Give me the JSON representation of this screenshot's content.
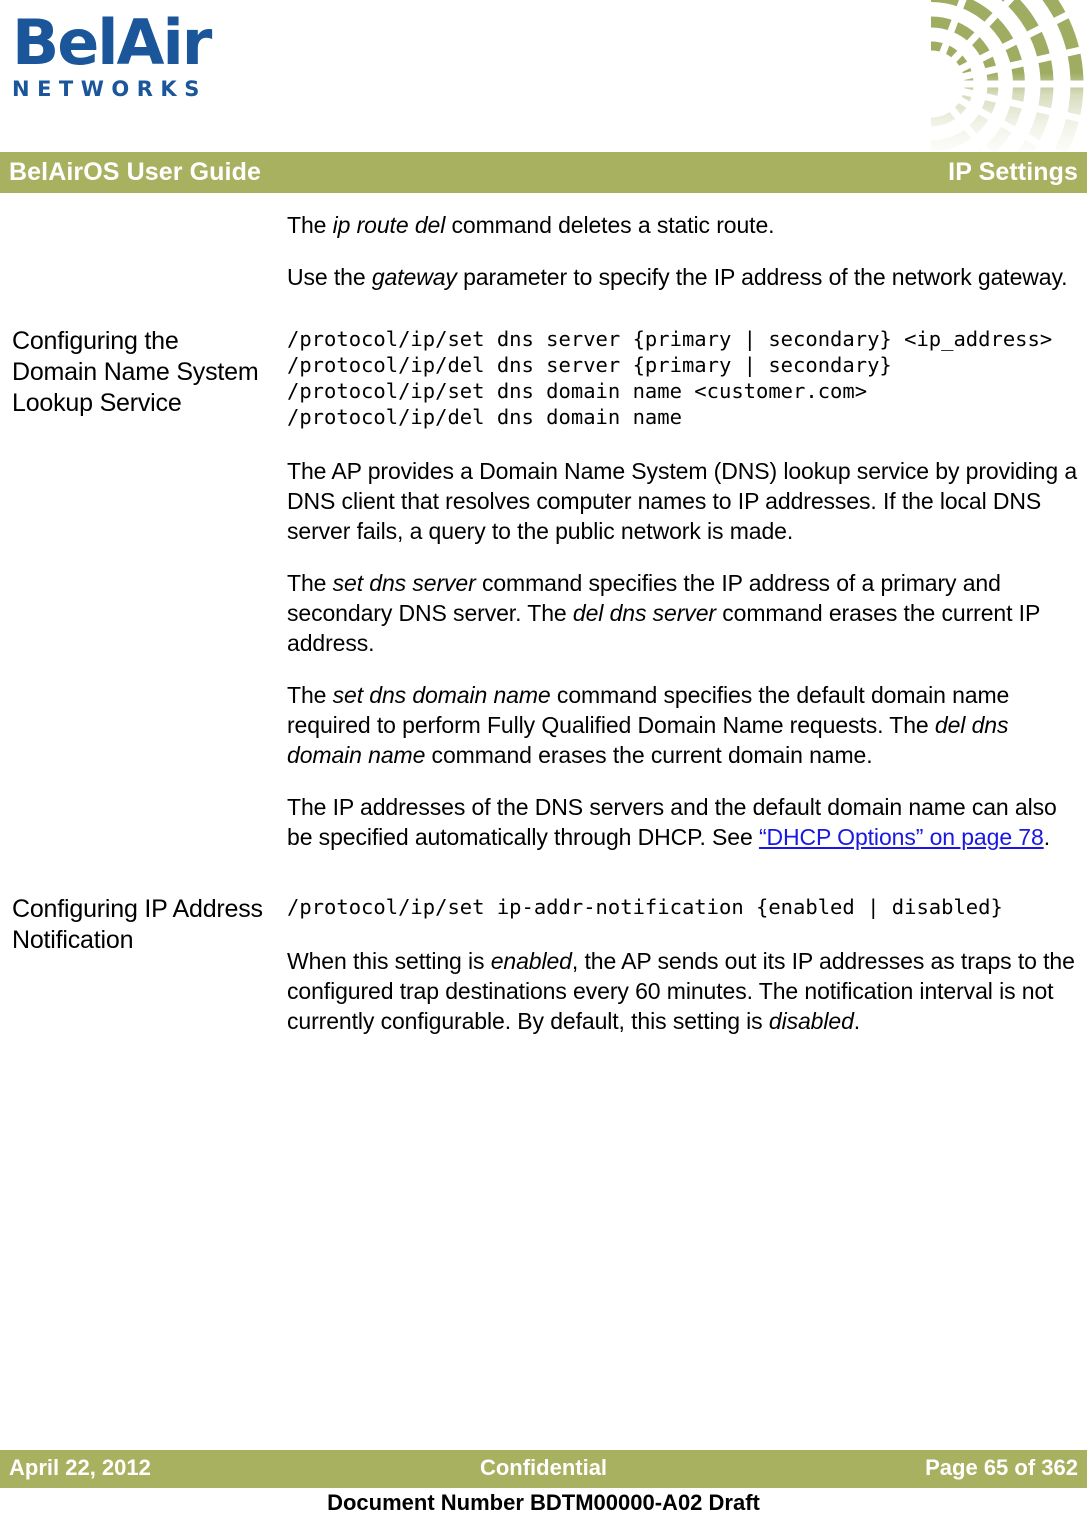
{
  "brand": {
    "logo_wordmark": "BelAir",
    "logo_subword": "NETWORKS",
    "logo_color": "#1A5699",
    "accent_color": "#A8B160",
    "link_color": "#1A18E0"
  },
  "header": {
    "title": "BelAirOS User Guide",
    "section": "IP Settings",
    "decor_icon": "radial-fan-graphic"
  },
  "intro": {
    "paragraphs": [
      {
        "runs": [
          {
            "t": "The ",
            "style": "normal"
          },
          {
            "t": "ip route del",
            "style": "italic"
          },
          {
            "t": " command deletes a static route.",
            "style": "normal"
          }
        ]
      },
      {
        "runs": [
          {
            "t": "Use the ",
            "style": "normal"
          },
          {
            "t": "gateway",
            "style": "italic"
          },
          {
            "t": " parameter to specify the IP address of the network gateway.",
            "style": "normal"
          }
        ]
      }
    ]
  },
  "sections": [
    {
      "heading": "Configuring the Domain Name System Lookup Service",
      "code": "/protocol/ip/set dns server {primary | secondary} <ip_address>\n/protocol/ip/del dns server {primary | secondary}\n/protocol/ip/set dns domain name <customer.com>\n/protocol/ip/del dns domain name",
      "paragraphs": [
        {
          "runs": [
            {
              "t": "The AP provides a Domain Name System (DNS) lookup service by providing a DNS client that resolves computer names to IP addresses. If the local DNS server fails, a query to the public network is made.",
              "style": "normal"
            }
          ]
        },
        {
          "runs": [
            {
              "t": "The ",
              "style": "normal"
            },
            {
              "t": "set dns server",
              "style": "italic"
            },
            {
              "t": " command specifies the IP address of a primary and secondary DNS server. The ",
              "style": "normal"
            },
            {
              "t": "del dns server",
              "style": "italic"
            },
            {
              "t": " command erases the current IP address.",
              "style": "normal"
            }
          ]
        },
        {
          "runs": [
            {
              "t": "The ",
              "style": "normal"
            },
            {
              "t": "set dns domain name",
              "style": "italic"
            },
            {
              "t": " command specifies the default domain name required to perform Fully Qualified Domain Name requests. The ",
              "style": "normal"
            },
            {
              "t": "del dns domain name",
              "style": "italic"
            },
            {
              "t": " command erases the current domain name.",
              "style": "normal"
            }
          ]
        },
        {
          "runs": [
            {
              "t": "The IP addresses of the DNS servers and the default domain name can also be specified automatically through DHCP. See ",
              "style": "normal"
            },
            {
              "t": "“DHCP Options” on page 78",
              "style": "link"
            },
            {
              "t": ".",
              "style": "normal"
            }
          ]
        }
      ]
    },
    {
      "heading": "Configuring IP Address Notification",
      "code": "/protocol/ip/set ip-addr-notification {enabled | disabled}",
      "paragraphs": [
        {
          "runs": [
            {
              "t": "When this setting is ",
              "style": "normal"
            },
            {
              "t": "enabled",
              "style": "italic"
            },
            {
              "t": ", the AP sends out its IP addresses as traps to the configured trap destinations every 60 minutes. The notification interval is not currently configurable. By default, this setting is ",
              "style": "normal"
            },
            {
              "t": "disabled",
              "style": "italic"
            },
            {
              "t": ".",
              "style": "normal"
            }
          ]
        }
      ]
    }
  ],
  "footer": {
    "date": "April 22, 2012",
    "classification": "Confidential",
    "page": "Page 65 of 362",
    "document_number": "Document Number BDTM00000-A02 Draft"
  }
}
